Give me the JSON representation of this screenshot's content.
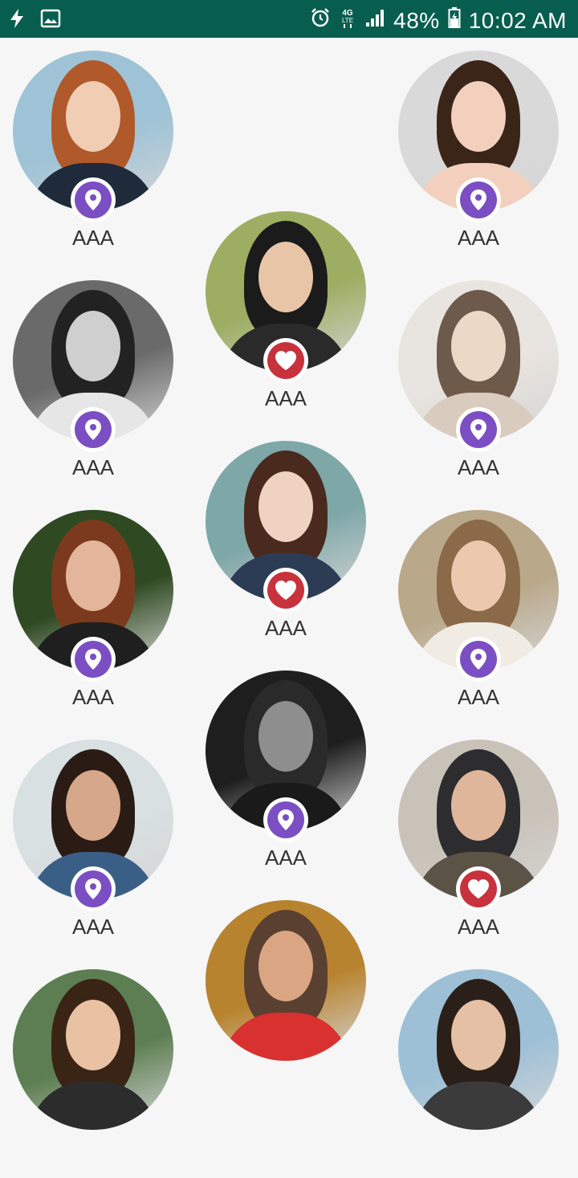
{
  "status_bar": {
    "battery": "48%",
    "time": "10:02 AM",
    "icons": [
      "flash-icon",
      "image-icon",
      "alarm-icon",
      "4g-lte-icon",
      "signal-icon",
      "battery-icon"
    ]
  },
  "colors": {
    "status_bar": "#075e4e",
    "location_badge": "#7b4fc3",
    "favorite_badge": "#c8323c"
  },
  "profiles": [
    {
      "name": "AAA",
      "badge": "location",
      "bg": "#9fc3d6",
      "hair": "#b0592a",
      "skin": "#f1cdb4",
      "shirt": "#1f2a3b"
    },
    {
      "name": "AAA",
      "badge": "location",
      "bg": "#d9d9d9",
      "hair": "#3a2518",
      "skin": "#f2d0bd",
      "shirt": "#f2d0bd"
    },
    {
      "name": "AAA",
      "badge": "favorite",
      "bg": "#9dae63",
      "hair": "#1b1b1b",
      "skin": "#e9c5a8",
      "shirt": "#2a2a2a"
    },
    {
      "name": "AAA",
      "badge": "location",
      "bg": "#6a6a6a",
      "hair": "#222222",
      "skin": "#cfcfcf",
      "shirt": "#e6e6e6"
    },
    {
      "name": "AAA",
      "badge": "location",
      "bg": "#e8e4df",
      "hair": "#6e5a4a",
      "skin": "#ecd8c6",
      "shirt": "#d9ccbf"
    },
    {
      "name": "AAA",
      "badge": "favorite",
      "bg": "#7ea7a8",
      "hair": "#4a2a1e",
      "skin": "#efd2c1",
      "shirt": "#2d3c55"
    },
    {
      "name": "AAA",
      "badge": "location",
      "bg": "#2f4a22",
      "hair": "#7b3a1e",
      "skin": "#e3b59b",
      "shirt": "#1f1f1f"
    },
    {
      "name": "AAA",
      "badge": "location",
      "bg": "#b9a88a",
      "hair": "#8a6a48",
      "skin": "#ecc9ae",
      "shirt": "#f0ece4"
    },
    {
      "name": "AAA",
      "badge": "location",
      "bg": "#1e1e1e",
      "hair": "#2a2a2a",
      "skin": "#8e8e8e",
      "shirt": "#1a1a1a"
    },
    {
      "name": "AAA",
      "badge": "location",
      "bg": "#d8e0e2",
      "hair": "#2a1c14",
      "skin": "#d7a78a",
      "shirt": "#3a5f86"
    },
    {
      "name": "AAA",
      "badge": "favorite",
      "bg": "#c9c2b8",
      "hair": "#2d2d30",
      "skin": "#e0b69b",
      "shirt": "#5b5446"
    },
    {
      "name": "",
      "badge": "none",
      "bg": "#b8832f",
      "hair": "#5a4030",
      "skin": "#d9a583",
      "shirt": "#d93030"
    },
    {
      "name": "",
      "badge": "none",
      "bg": "#5d7e52",
      "hair": "#3a2416",
      "skin": "#e9c1a3",
      "shirt": "#2c2c2c"
    },
    {
      "name": "",
      "badge": "none",
      "bg": "#9dc0d6",
      "hair": "#2b2019",
      "skin": "#e6c0a4",
      "shirt": "#3b3b3b"
    }
  ]
}
